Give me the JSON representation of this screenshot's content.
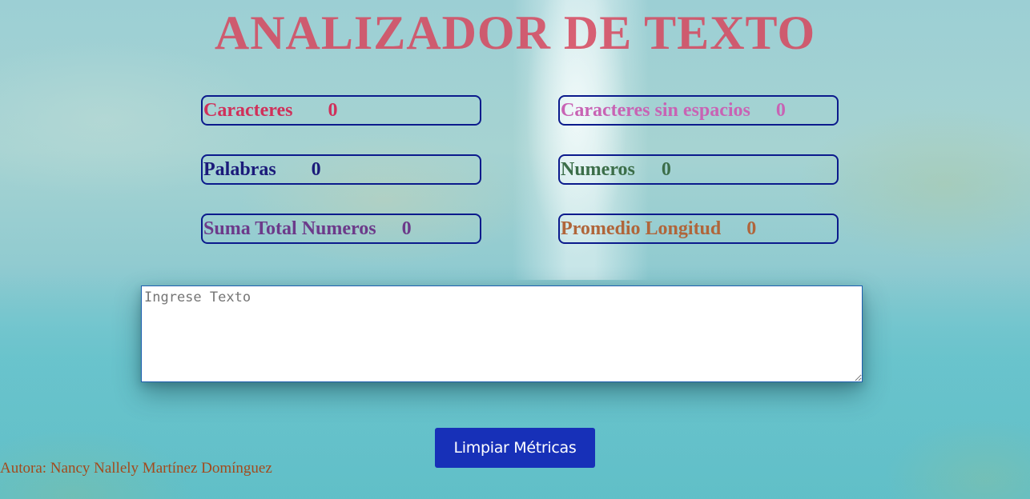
{
  "page": {
    "title": "ANALIZADOR DE TEXTO"
  },
  "metrics": {
    "caracteres": {
      "label": "Caracteres",
      "value": "0"
    },
    "caracteres_sin_espacios": {
      "label": "Caracteres sin espacios",
      "value": "0"
    },
    "palabras": {
      "label": "Palabras",
      "value": "0"
    },
    "numeros": {
      "label": "Numeros",
      "value": "0"
    },
    "suma_total_numeros": {
      "label": "Suma Total Numeros",
      "value": "0"
    },
    "promedio_longitud": {
      "label": "Promedio Longitud",
      "value": "0"
    }
  },
  "input": {
    "placeholder": "Ingrese Texto",
    "value": ""
  },
  "actions": {
    "clear_label": "Limpiar Métricas"
  },
  "footer": {
    "author": "Autora: Nancy Nallely Martínez Domínguez"
  },
  "colors": {
    "title": "#d7475e",
    "box_border": "#0b1a8c",
    "button": "#1730b8",
    "caracteres": "#d0305a",
    "caracteres_sin_espacios": "#c863b4",
    "palabras": "#1b1a7a",
    "numeros": "#3c6e49",
    "suma_total_numeros": "#6c3a8a",
    "promedio_longitud": "#b0653a",
    "author": "#a34a1c"
  }
}
